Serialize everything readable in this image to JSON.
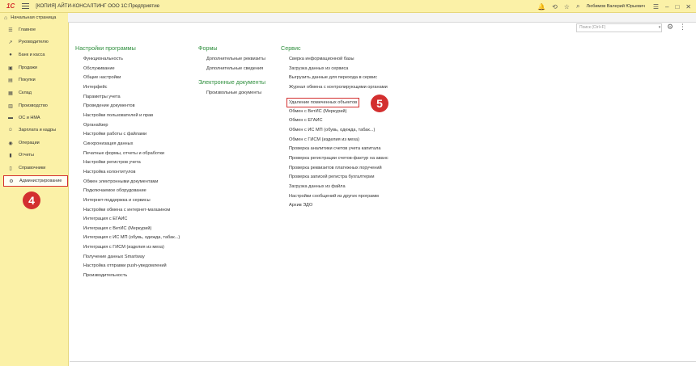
{
  "titlebar": {
    "logo": "1С",
    "app_title": "[КОПИЯ] АЙТИ-КОНСАЛТИНГ ООО 1С:Предприятие",
    "user_name": "Любимов Валерий Юрьевич",
    "icons": [
      "bell-icon",
      "history-icon",
      "star-icon",
      "search-icon",
      "menu-icon",
      "minimize-icon",
      "maximize-icon",
      "close-icon"
    ]
  },
  "tabbar": {
    "start_page": "Начальная страница"
  },
  "sidebar": {
    "items": [
      {
        "label": "Главное",
        "icon": "menu-lines-icon"
      },
      {
        "label": "Руководителю",
        "icon": "chart-trend-icon"
      },
      {
        "label": "Банк и касса",
        "icon": "coins-icon"
      },
      {
        "label": "Продажи",
        "icon": "cart-icon"
      },
      {
        "label": "Покупки",
        "icon": "basket-icon"
      },
      {
        "label": "Склад",
        "icon": "warehouse-icon"
      },
      {
        "label": "Производство",
        "icon": "factory-icon"
      },
      {
        "label": "ОС и НМА",
        "icon": "truck-icon"
      },
      {
        "label": "Зарплата и кадры",
        "icon": "people-icon"
      },
      {
        "label": "Операции",
        "icon": "operations-icon"
      },
      {
        "label": "Отчеты",
        "icon": "bar-chart-icon"
      },
      {
        "label": "Справочники",
        "icon": "book-icon"
      },
      {
        "label": "Администрирование",
        "icon": "gear-icon",
        "active": true
      }
    ],
    "step_badge": "4"
  },
  "main": {
    "search_placeholder": "Поиск (Ctrl+F)",
    "program_settings": {
      "heading": "Настройки программы",
      "links": [
        "Функциональность",
        "Обслуживание",
        "Общие настройки",
        "Интерфейс",
        "Параметры учета",
        "Проведение документов",
        "Настройки пользователей и прав",
        "Органайзер",
        "Настройки работы с файлами",
        "Синхронизация данных",
        "Печатные формы, отчеты и обработки",
        "Настройки регистров учета",
        "Настройка колонтитулов",
        "Обмен электронными документами",
        "Подключаемое оборудование",
        "Интернет-поддержка и сервисы",
        "Настройки обмена с интернет-магазином",
        "Интеграция с ЕГАИС",
        "Интеграция с ВетИС (Меркурий)",
        "Интеграция с ИС МП (обувь, одежда, табак...)",
        "Интеграция с ГИСМ (изделия из меха)",
        "Получение данных Smartway",
        "Настройка отправки push-уведомлений",
        "Производительность"
      ]
    },
    "forms": {
      "heading": "Формы",
      "links": [
        "Дополнительные реквизиты",
        "Дополнительные сведения"
      ]
    },
    "edocs": {
      "heading": "Электронные документы",
      "links": [
        "Произвольные документы"
      ]
    },
    "service": {
      "heading": "Сервис",
      "links": [
        "Сверка информационной базы",
        "Загрузка данных из сервиса",
        "Выгрузить данные для перехода в сервис",
        "Журнал обмена с контролирующими органами",
        "Удаление помеченных объектов",
        "Обмен с ВетИС (Меркурий)",
        "Обмен с ЕГАИС",
        "Обмен с ИС МП (обувь, одежда, табак...)",
        "Обмен с ГИСМ (изделия из меха)",
        "Проверка аналитики счетов учета капитала",
        "Проверка регистрации счетов-фактур на аванс",
        "Проверка реквизитов платежных поручений",
        "Проверка записей регистра бухгалтерии",
        "Загрузка данных из файла",
        "Настройки сообщений из других программ",
        "Архив ЭДО"
      ],
      "highlighted_index": 4,
      "step_badge": "5"
    }
  }
}
